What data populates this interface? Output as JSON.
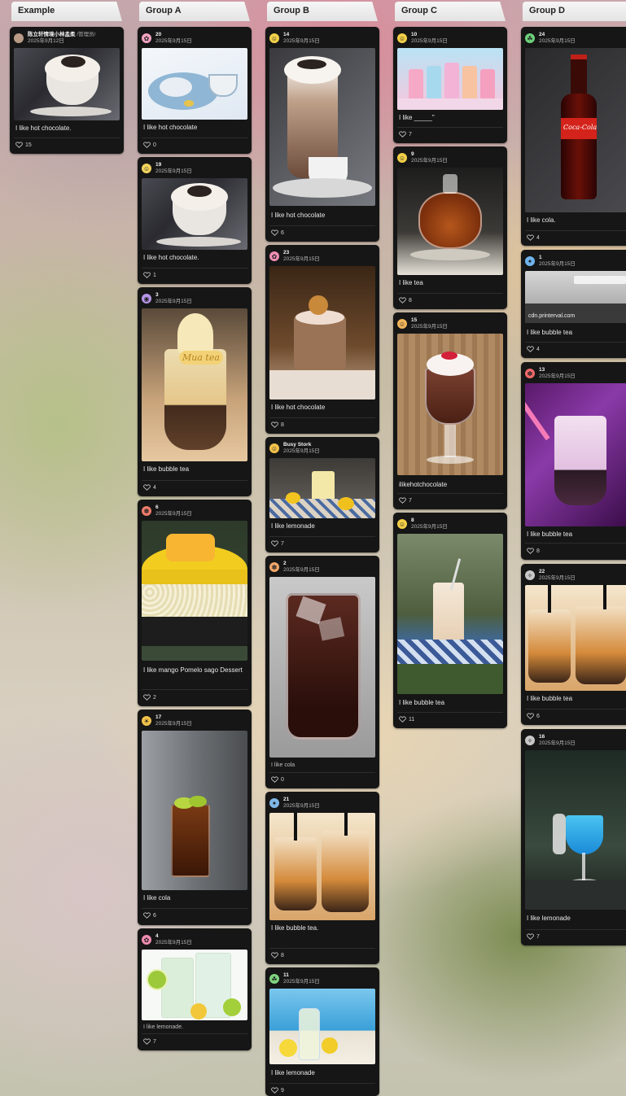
{
  "columns": {
    "example": {
      "title": "Example"
    },
    "group_a": {
      "title": "Group A"
    },
    "group_b": {
      "title": "Group B"
    },
    "group_c": {
      "title": "Group C"
    },
    "group_d": {
      "title": "Group D"
    }
  },
  "cards": {
    "ex": {
      "author": "陈立轩情境小林孟柔",
      "role": "/管理员/",
      "date": "2025年9月12日",
      "caption": "I like hot chocolate.",
      "likes": "15"
    },
    "a20": {
      "author": "20",
      "date": "2025年9月15日",
      "caption": "I like hot chocolate",
      "likes": "0"
    },
    "a19": {
      "author": "19",
      "date": "2025年9月15日",
      "caption": "I like hot chocolate.",
      "likes": "1"
    },
    "a3": {
      "author": "3",
      "date": "2025年9月15日",
      "caption": "I like bubble tea",
      "likes": "4",
      "pic_text": "Mua tea"
    },
    "a6": {
      "author": "6",
      "date": "2025年9月15日",
      "caption": "I like mango Pomelo sago Dessert",
      "likes": "2"
    },
    "a17": {
      "author": "17",
      "date": "2025年9月15日",
      "caption": "I like cola",
      "likes": "6"
    },
    "a4": {
      "author": "4",
      "date": "2025年9月15日",
      "caption": "I like lemonade.",
      "likes": "7"
    },
    "b14": {
      "author": "14",
      "date": "2025年9月15日",
      "caption": "I like  hot chocolate",
      "likes": "6"
    },
    "b23": {
      "author": "23",
      "date": "2025年9月15日",
      "caption": "I like hot chocolate",
      "likes": "8"
    },
    "bbusy": {
      "author": "Busy Stork",
      "date": "2025年9月15日",
      "caption": "I like lemonade",
      "likes": "7"
    },
    "b2": {
      "author": "2",
      "date": "2025年9月15日",
      "caption": "I like cola",
      "likes": "0"
    },
    "b21": {
      "author": "21",
      "date": "2025年9月15日",
      "caption": "I like bubble tea.",
      "likes": "8"
    },
    "b11": {
      "author": "11",
      "date": "2025年9月15日",
      "caption": "I like lemonade",
      "likes": "9"
    },
    "c10": {
      "author": "10",
      "date": "2025年9月15日",
      "caption": "I like _____\"",
      "likes": "7"
    },
    "c9": {
      "author": "9",
      "date": "2025年9月15日",
      "caption": "I like tea",
      "likes": "8"
    },
    "c15": {
      "author": "15",
      "date": "2025年9月15日",
      "caption": "ilikehotchocolate",
      "likes": "7"
    },
    "c8": {
      "author": "8",
      "date": "2025年9月15日",
      "caption": "I like bubble tea",
      "likes": "11"
    },
    "d24": {
      "author": "24",
      "date": "2025年9月15日",
      "caption": "I like cola.",
      "likes": "4",
      "pic_text": "Coca-Cola"
    },
    "d1": {
      "author": "1",
      "date": "2025年9月15日",
      "caption": "I like bubble tea",
      "likes": "4",
      "pic_text": "cdn.printerval.com"
    },
    "d13": {
      "author": "13",
      "date": "2025年9月15日",
      "caption": "I like bubble tea",
      "likes": "8"
    },
    "d22": {
      "author": "22",
      "date": "2025年9月15日",
      "caption": "I  like bubble tea",
      "likes": "6"
    },
    "d16": {
      "author": "16",
      "date": "2025年9月15日",
      "caption": "I like lemonade",
      "likes": "7"
    }
  },
  "colors": {
    "card_bg": "#161616",
    "header_bg": "#eeeeee",
    "header_text": "#222222"
  },
  "icons": {
    "likes": "heart-outline-icon"
  }
}
